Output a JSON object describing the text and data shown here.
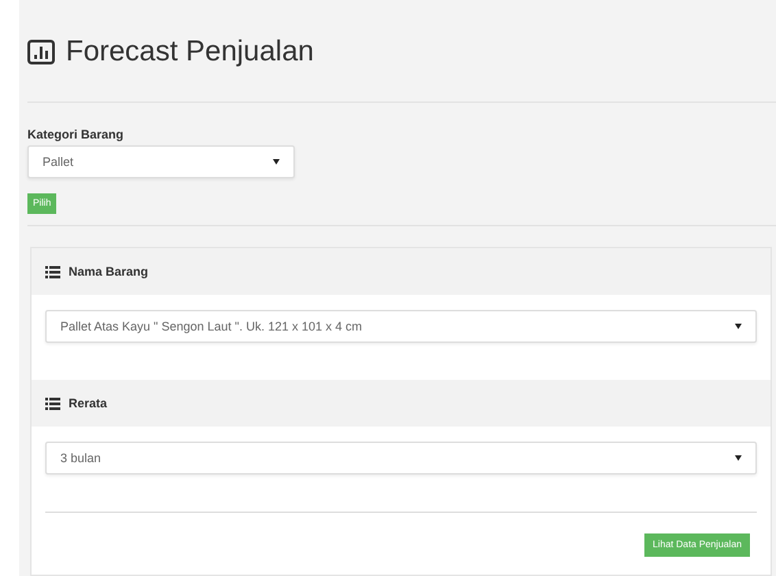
{
  "page": {
    "title": "Forecast Penjualan"
  },
  "category": {
    "label": "Kategori Barang",
    "value": "Pallet",
    "button": "Pilih"
  },
  "panel": {
    "sections": [
      {
        "heading": "Nama Barang",
        "value": "Pallet Atas Kayu \" Sengon Laut \". Uk. 121 x 101 x 4 cm"
      },
      {
        "heading": "Rerata",
        "value": "3 bulan"
      }
    ],
    "button": "Lihat Data Penjualan"
  }
}
